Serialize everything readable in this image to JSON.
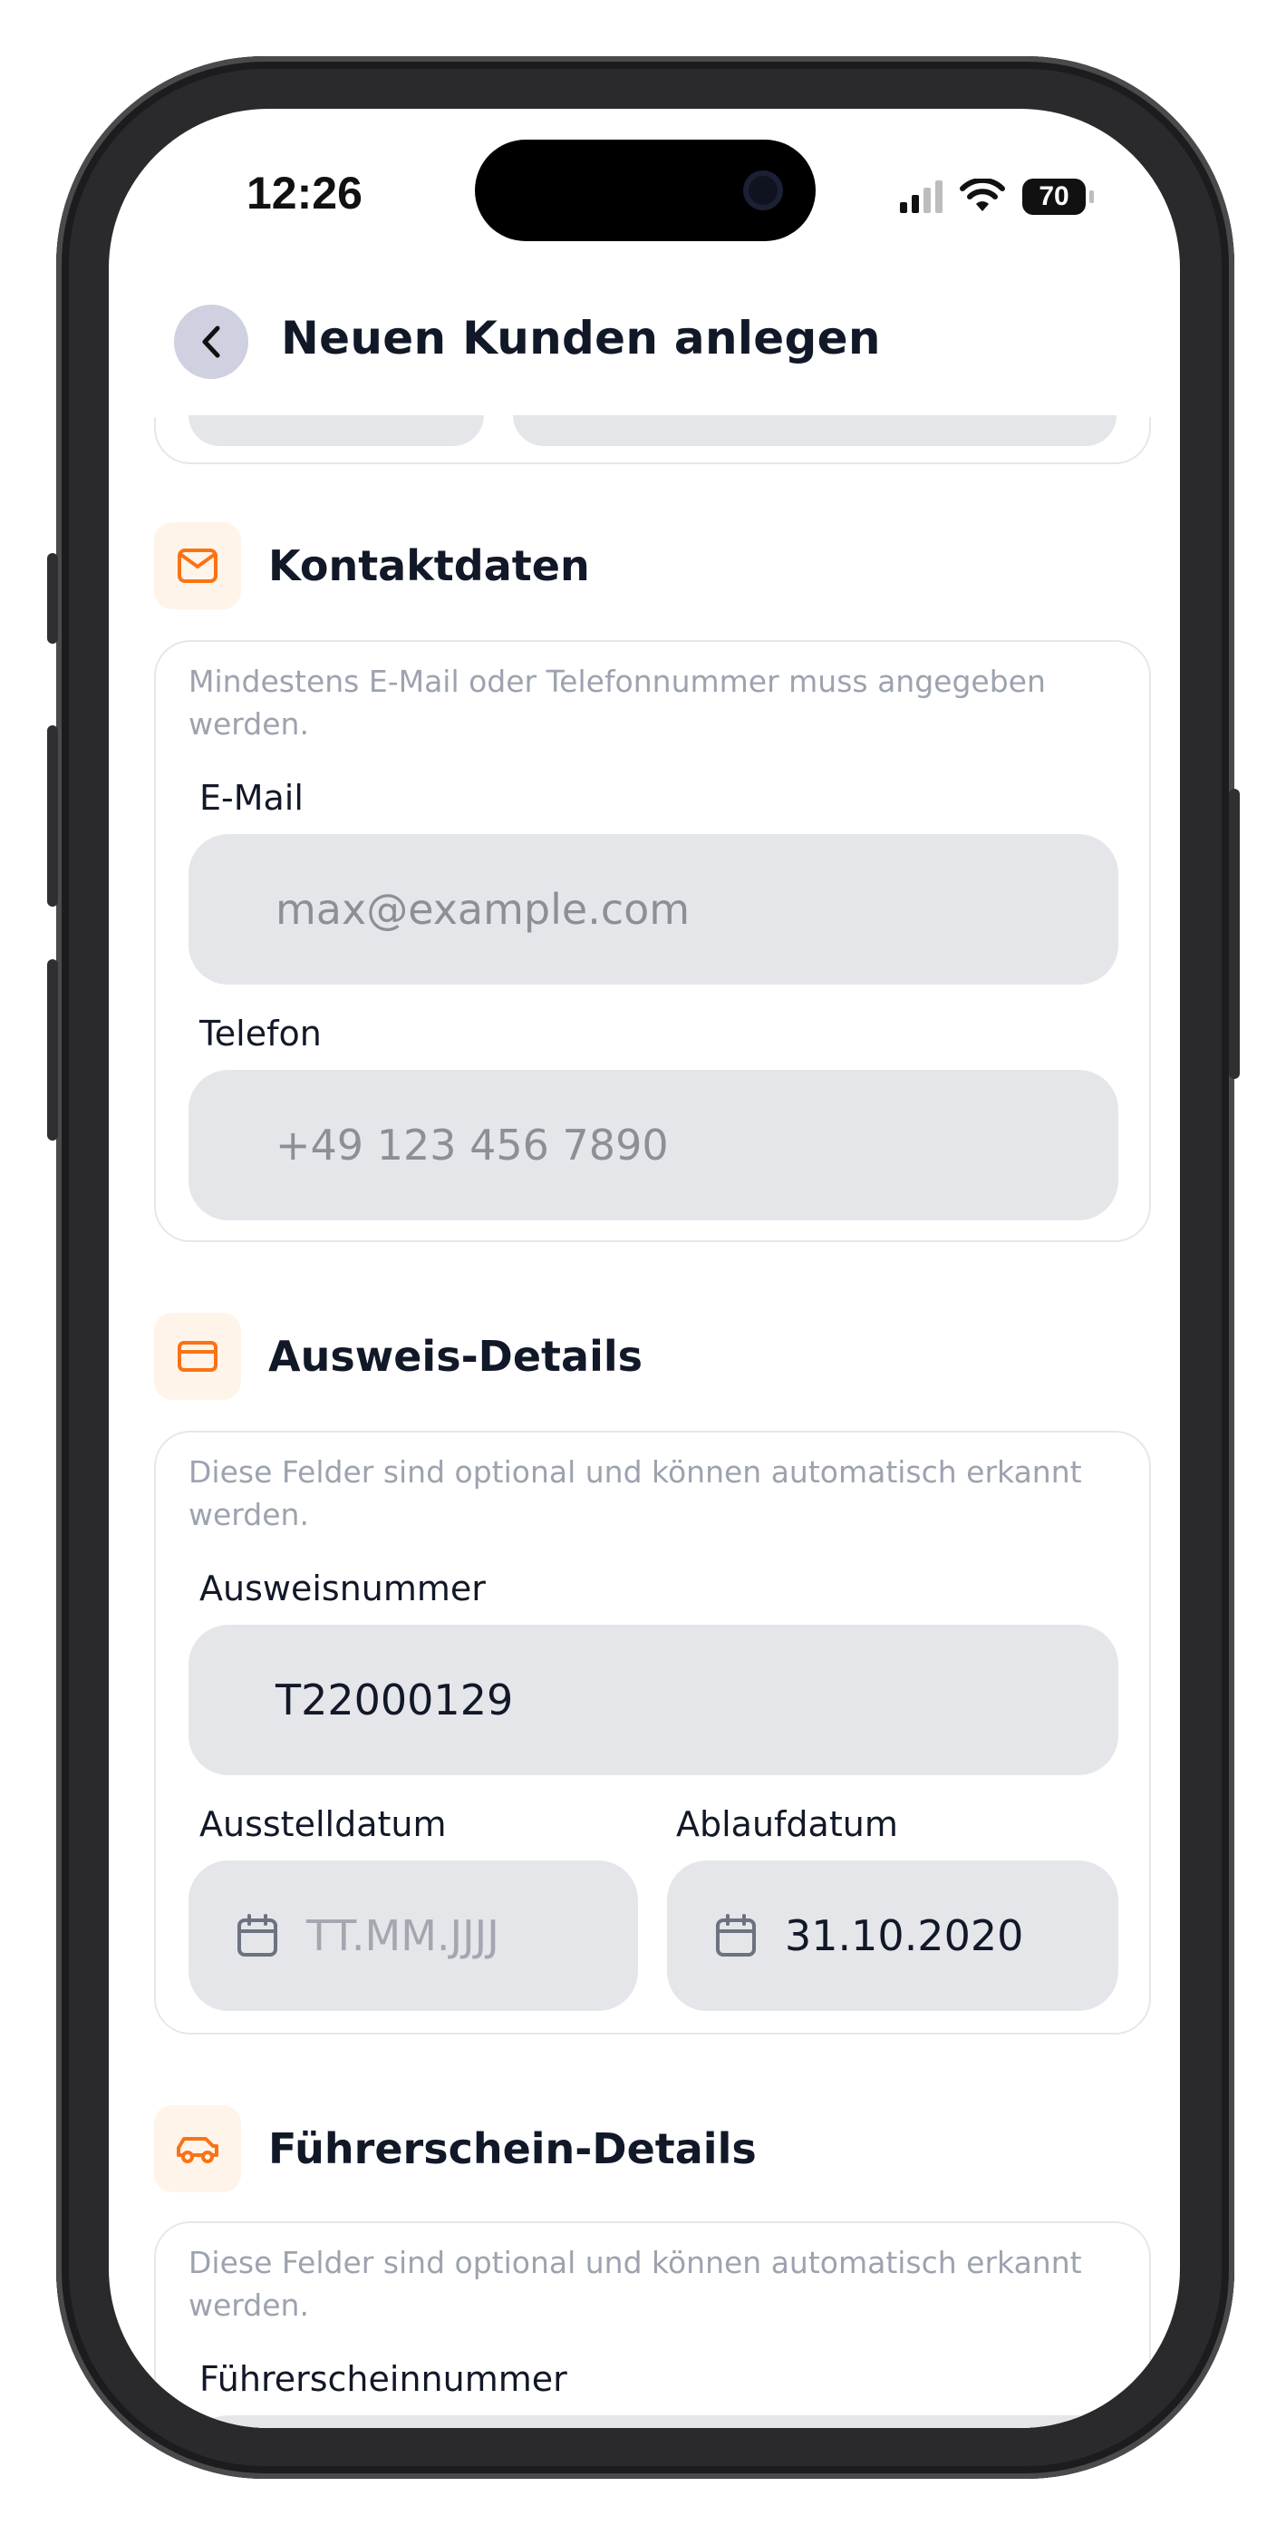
{
  "status_bar": {
    "time": "12:26",
    "battery": "70"
  },
  "header": {
    "title": "Neuen Kunden anlegen"
  },
  "contact": {
    "title": "Kontaktdaten",
    "hint": "Mindestens E-Mail oder Telefonnummer muss angegeben werden.",
    "email_label": "E-Mail",
    "email_placeholder": "max@example.com",
    "phone_label": "Telefon",
    "phone_placeholder": "+49 123 456 7890"
  },
  "id_details": {
    "title": "Ausweis-Details",
    "hint": "Diese Felder sind optional und können automatisch erkannt werden.",
    "number_label": "Ausweisnummer",
    "number_value": "T22000129",
    "issue_label": "Ausstelldatum",
    "issue_placeholder": "TT.MM.JJJJ",
    "expiry_label": "Ablaufdatum",
    "expiry_value": "31.10.2020"
  },
  "license": {
    "title": "Führerschein-Details",
    "hint": "Diese Felder sind optional und können automatisch erkannt werden.",
    "number_label": "Führerscheinnummer"
  },
  "colors": {
    "accent": "#f97316",
    "accent_bg": "#fff4ea",
    "input_bg": "#e5e6ea"
  }
}
